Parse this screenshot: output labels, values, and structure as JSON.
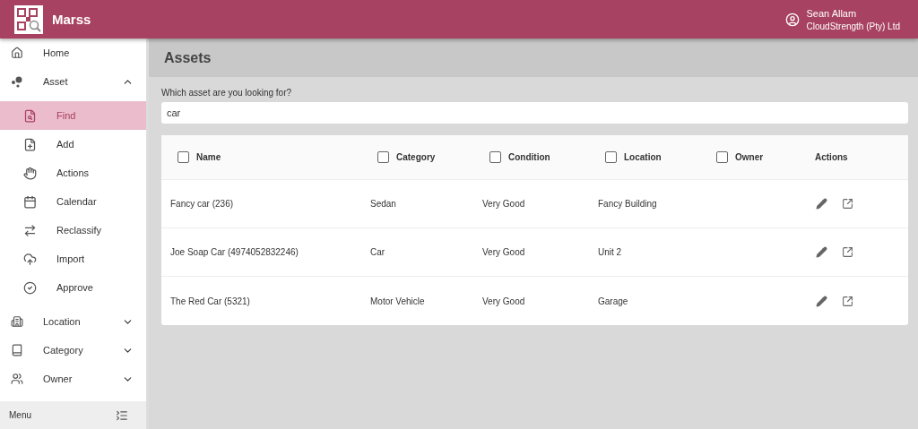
{
  "app": {
    "title": "Marss"
  },
  "user": {
    "name": "Sean Allam",
    "company": "CloudStrength (Pty) Ltd"
  },
  "sidebar": {
    "items": [
      {
        "label": "Home",
        "kind": "link",
        "selected": false
      },
      {
        "label": "Asset",
        "kind": "section",
        "expanded": true,
        "selected": false,
        "children": [
          {
            "label": "Find",
            "selected": true
          },
          {
            "label": "Add",
            "selected": false
          },
          {
            "label": "Actions",
            "selected": false
          },
          {
            "label": "Calendar",
            "selected": false
          },
          {
            "label": "Reclassify",
            "selected": false
          },
          {
            "label": "Import",
            "selected": false
          },
          {
            "label": "Approve",
            "selected": false
          }
        ]
      },
      {
        "label": "Location",
        "kind": "section",
        "expanded": false,
        "selected": false
      },
      {
        "label": "Category",
        "kind": "section",
        "expanded": false,
        "selected": false
      },
      {
        "label": "Owner",
        "kind": "section",
        "expanded": false,
        "selected": false
      }
    ],
    "footer": "Menu"
  },
  "page": {
    "title": "Assets"
  },
  "search": {
    "label": "Which asset are you looking for?",
    "value": "car"
  },
  "table": {
    "columns": [
      {
        "label": "Name",
        "checked": false,
        "kind": "check"
      },
      {
        "label": "Category",
        "checked": false,
        "kind": "check"
      },
      {
        "label": "Condition",
        "checked": false,
        "kind": "check"
      },
      {
        "label": "Location",
        "checked": false,
        "kind": "check"
      },
      {
        "label": "Owner",
        "checked": false,
        "kind": "check"
      },
      {
        "label": "Actions",
        "kind": "plain"
      }
    ],
    "rows": [
      [
        "Fancy car (236)",
        "Sedan",
        "Very Good",
        "Fancy Building",
        ""
      ],
      [
        "Joe Soap Car (4974052832246)",
        "Car",
        "Very Good",
        "Unit 2",
        ""
      ],
      [
        "The Red Car (5321)",
        "Motor Vehicle",
        "Very Good",
        "Garage",
        ""
      ]
    ]
  }
}
